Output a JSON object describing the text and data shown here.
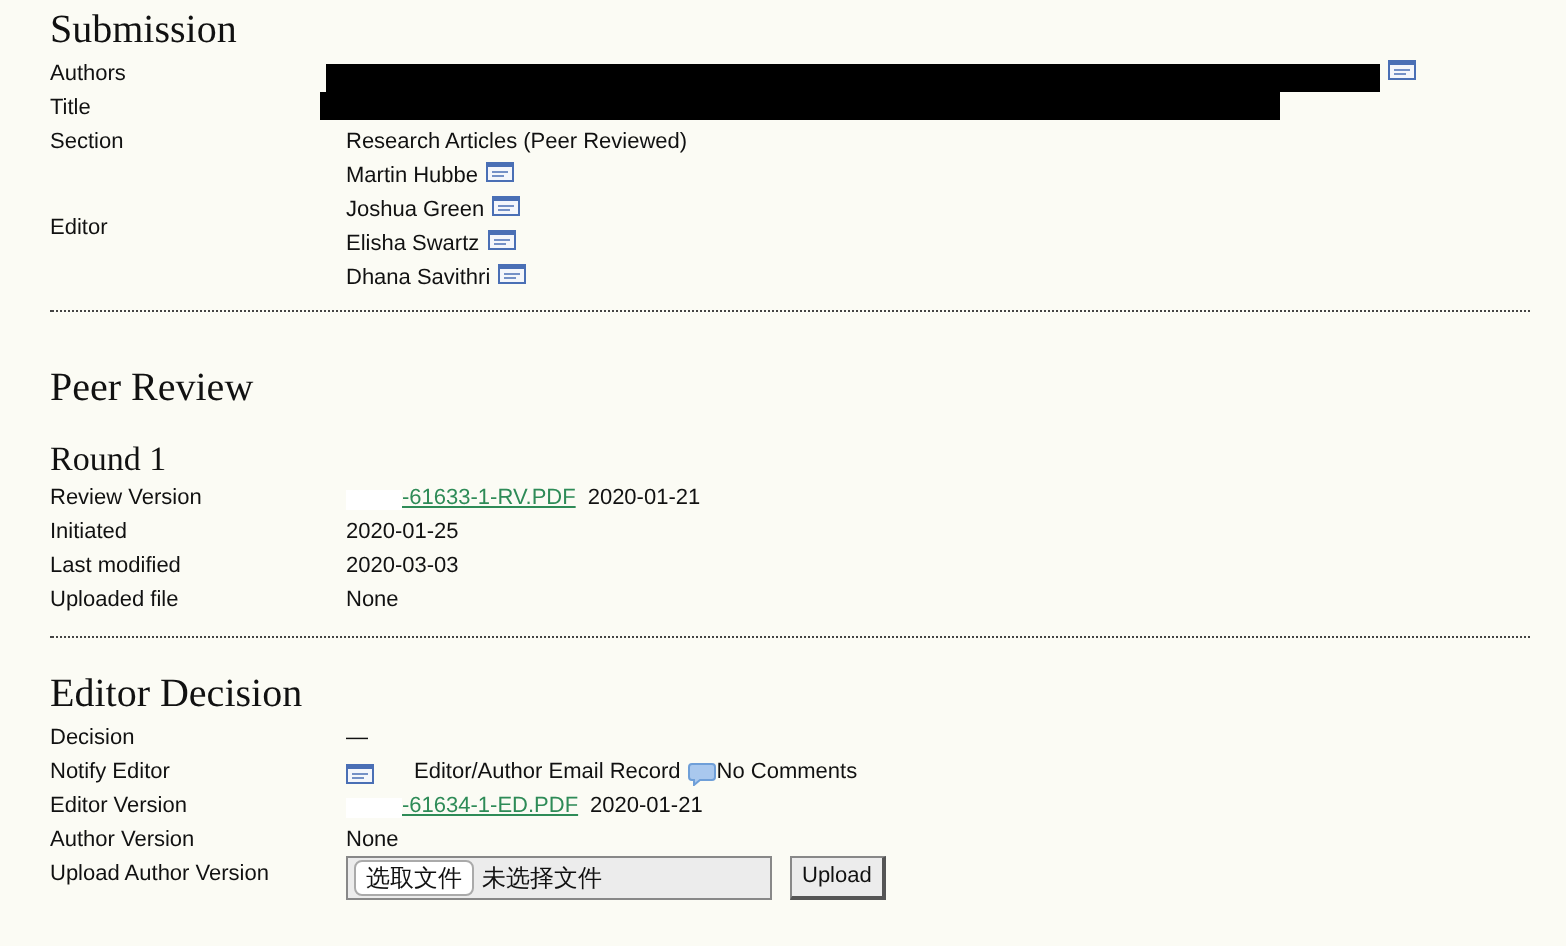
{
  "submission": {
    "heading": "Submission",
    "fields": [
      {
        "kind": "redacted",
        "label": "Authors",
        "email": true
      },
      {
        "kind": "redacted",
        "label": "Title",
        "email": false
      },
      {
        "kind": "text",
        "label": "Section",
        "value": "Research Articles (Peer Reviewed)"
      },
      {
        "kind": "people",
        "label": "Editor",
        "people": [
          "Martin Hubbe",
          "Joshua Green",
          "Elisha Swartz",
          "Dhana Savithri"
        ]
      }
    ]
  },
  "peer_review": {
    "heading": "Peer Review",
    "round": "Round 1",
    "fields": [
      {
        "kind": "file",
        "label": "Review Version",
        "link": "-61633-1-RV.PDF",
        "date": "2020-01-21"
      },
      {
        "kind": "text",
        "label": "Initiated",
        "value": "2020-01-25"
      },
      {
        "kind": "text",
        "label": "Last modified",
        "value": "2020-03-03"
      },
      {
        "kind": "text",
        "label": "Uploaded file",
        "value": "None"
      }
    ]
  },
  "editor_decision": {
    "heading": "Editor Decision",
    "fields": [
      {
        "kind": "text",
        "label": "Decision",
        "value": "—"
      },
      {
        "kind": "notify",
        "label": "Notify Editor",
        "record": "Editor/Author Email Record",
        "comments": "No Comments"
      },
      {
        "kind": "file",
        "label": "Editor Version",
        "link": "-61634-1-ED.PDF",
        "date": "2020-01-21"
      },
      {
        "kind": "text",
        "label": "Author Version",
        "value": "None"
      },
      {
        "kind": "upload",
        "label": "Upload Author Version",
        "choose": "选取文件",
        "status": "未选择文件",
        "button": "Upload"
      }
    ]
  }
}
